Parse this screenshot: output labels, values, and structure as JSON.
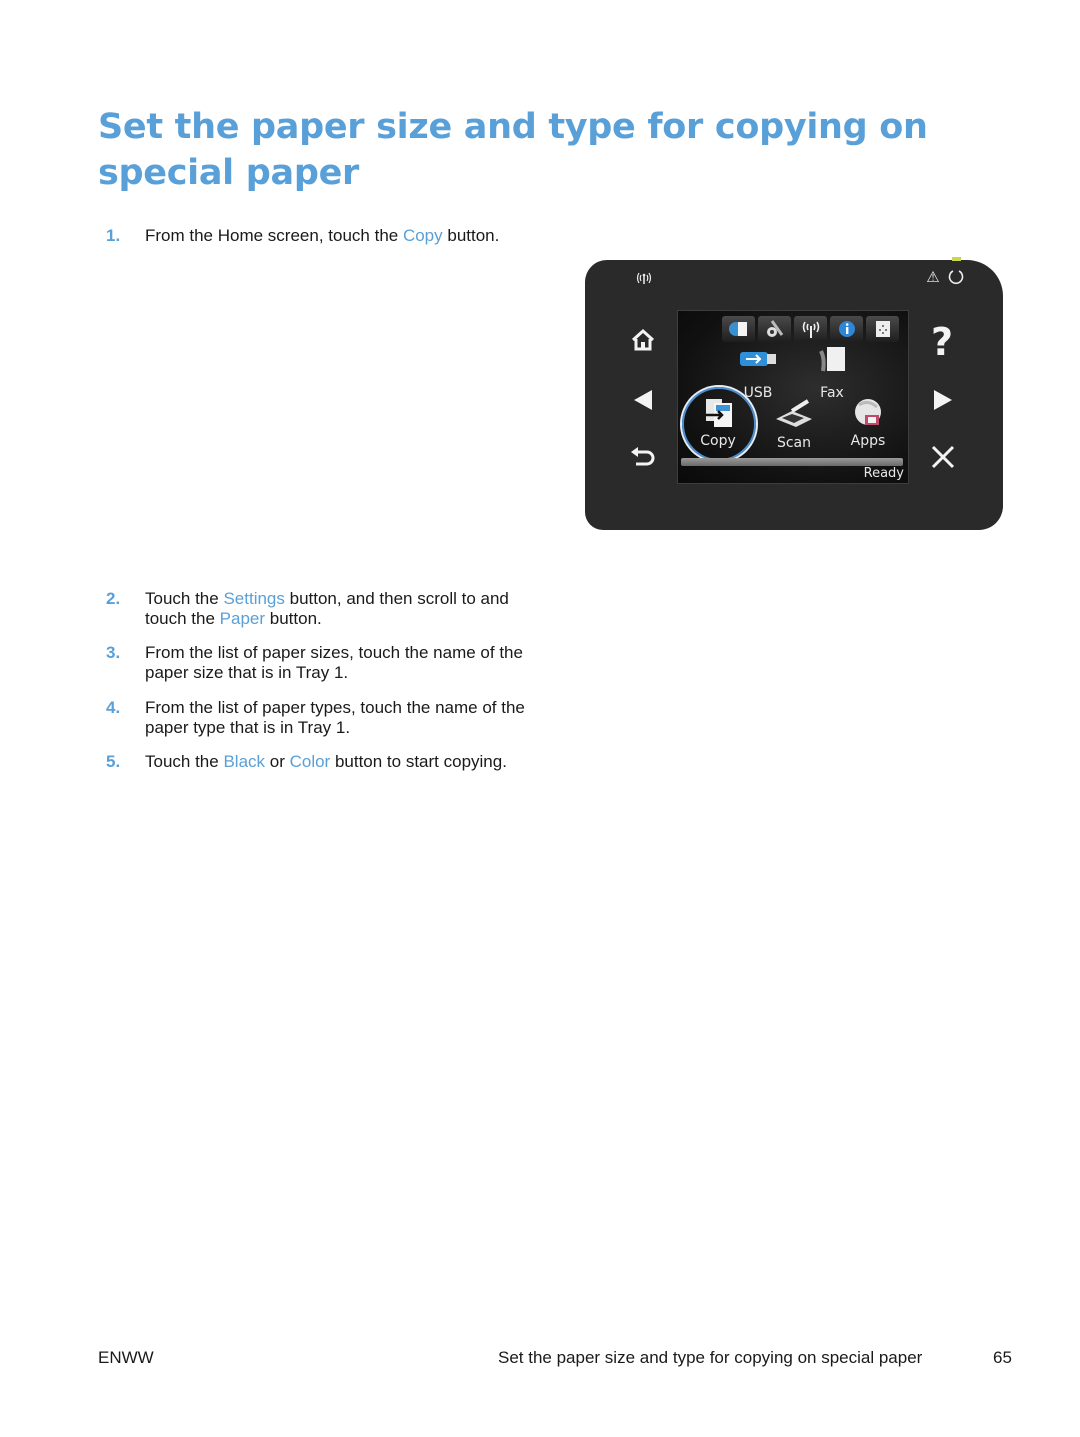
{
  "page": {
    "title": "Set the paper size and type for copying on special paper",
    "steps": [
      {
        "number": "1.",
        "parts": [
          {
            "text": "From the Home screen, touch the "
          },
          {
            "text": "Copy",
            "link": true
          },
          {
            "text": " button."
          }
        ]
      },
      {
        "number": "2.",
        "parts": [
          {
            "text": "Touch the "
          },
          {
            "text": "Settings",
            "link": true
          },
          {
            "text": " button, and then scroll to and touch the "
          },
          {
            "text": "Paper",
            "link": true
          },
          {
            "text": " button."
          }
        ]
      },
      {
        "number": "3.",
        "parts": [
          {
            "text": "From the list of paper sizes, touch the name of the paper size that is in Tray 1."
          }
        ]
      },
      {
        "number": "4.",
        "parts": [
          {
            "text": "From the list of paper types, touch the name of the paper type that is in Tray 1."
          }
        ]
      },
      {
        "number": "5.",
        "parts": [
          {
            "text": "Touch the "
          },
          {
            "text": "Black",
            "link": true
          },
          {
            "text": " or "
          },
          {
            "text": "Color",
            "link": true
          },
          {
            "text": " button to start copying."
          }
        ]
      }
    ]
  },
  "printer_panel": {
    "left_buttons": [
      "wireless-icon",
      "home-icon",
      "left-arrow-icon",
      "back-icon"
    ],
    "right_buttons": [
      "warning-icon",
      "power-icon",
      "help-icon",
      "right-arrow-icon",
      "cancel-icon"
    ],
    "top_icons": [
      "web-services-icon",
      "setup-icon",
      "wireless-icon",
      "info-icon",
      "supplies-icon"
    ],
    "apps": [
      {
        "label": "USB",
        "icon": "usb-icon"
      },
      {
        "label": "Fax",
        "icon": "fax-icon"
      },
      {
        "label": "Copy",
        "icon": "copy-icon",
        "highlighted": true
      },
      {
        "label": "Scan",
        "icon": "scan-icon"
      },
      {
        "label": "Apps",
        "icon": "apps-icon"
      }
    ],
    "status": "Ready",
    "glyphs": {
      "wireless": "((ı))",
      "help": "?",
      "warning": "⚠",
      "cancel": "✕"
    }
  },
  "footer": {
    "left": "ENWW",
    "center": "Set the paper size and type for copying on special paper",
    "page_number": "65"
  },
  "colors": {
    "accent": "#5aa0d8",
    "panel": "#2b2a2a",
    "highlight_ring": "#4d8fce"
  }
}
